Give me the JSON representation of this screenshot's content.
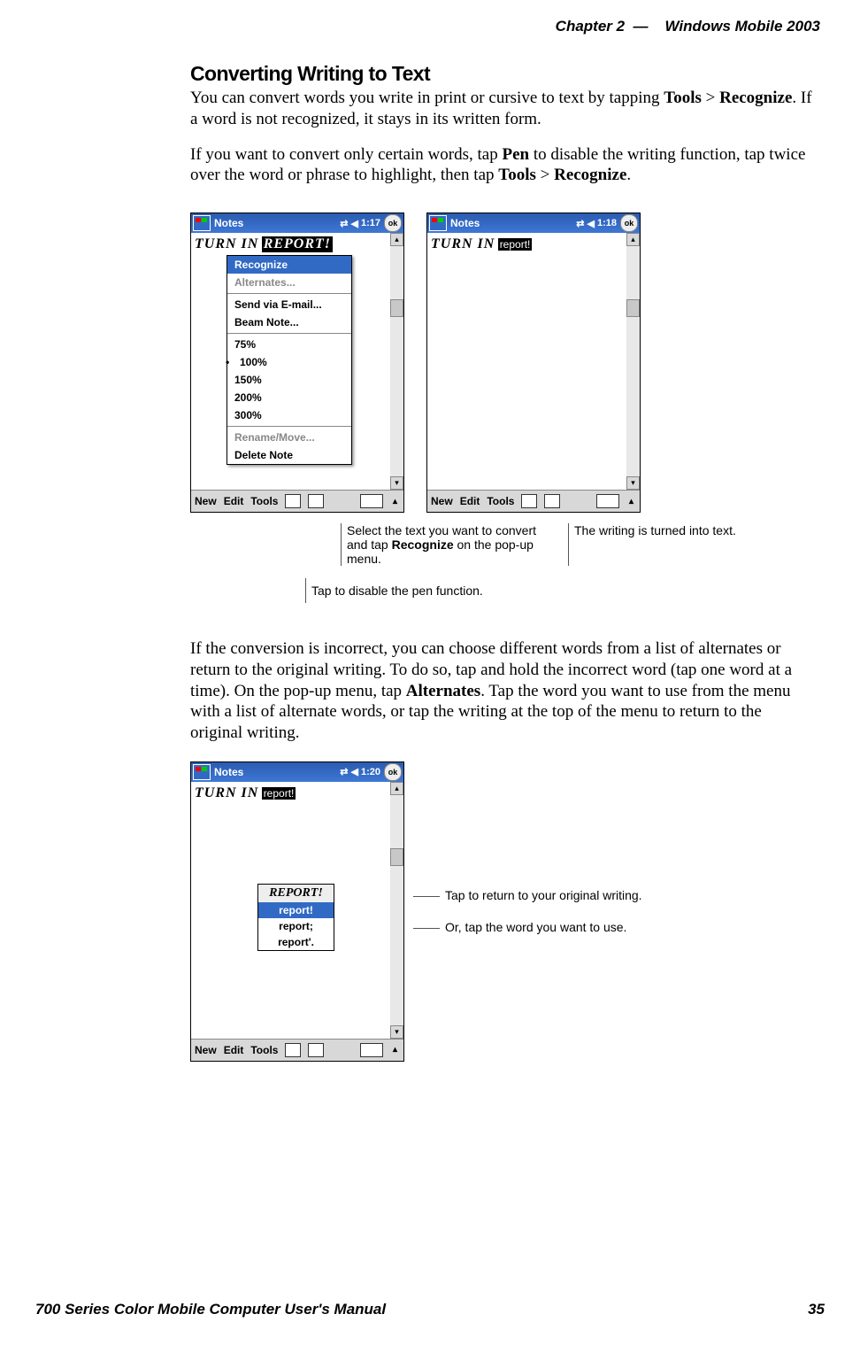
{
  "header": {
    "chapter": "Chapter  2",
    "dash": "—",
    "product": "Windows Mobile 2003"
  },
  "section_title": "Converting Writing to Text",
  "para1_a": "You can convert words you write in print or cursive to text by tapping ",
  "para1_tools": "Tools",
  "para1_gt": " > ",
  "para1_recognize": "Recognize",
  "para1_b": ". If a word is not recognized, it stays in its written form.",
  "para2_a": "If you want to convert only certain words, tap ",
  "para2_pen": "Pen",
  "para2_b": " to disable the writing function, tap twice over the word or phrase to highlight, then tap ",
  "para2_tools": "Tools",
  "para2_gt": " > ",
  "para2_recognize": "Recognize",
  "para2_c": ".",
  "shot1": {
    "title": "Notes",
    "time": "1:17",
    "handwriting_a": "TURN IN",
    "handwriting_b": "REPORT!",
    "menu": {
      "recognize": "Recognize",
      "alternates": "Alternates...",
      "send_email": "Send via E-mail...",
      "beam": "Beam Note...",
      "z75": "75%",
      "z100": "100%",
      "z150": "150%",
      "z200": "200%",
      "z300": "300%",
      "rename": "Rename/Move...",
      "delete": "Delete Note"
    },
    "bottom": {
      "new": "New",
      "edit": "Edit",
      "tools": "Tools"
    }
  },
  "shot2": {
    "title": "Notes",
    "time": "1:18",
    "handwriting_a": "TURN IN",
    "converted": "report!",
    "bottom": {
      "new": "New",
      "edit": "Edit",
      "tools": "Tools"
    }
  },
  "callout1_a": "Select the text you want to convert and tap ",
  "callout1_b": "Recognize",
  "callout1_c": " on the pop-up menu.",
  "callout2": "The writing is turned into text.",
  "callout3": "Tap to disable the pen function.",
  "para3_a": "If the conversion is incorrect, you can choose different words from a list of alternates or return to the original writing. To do so, tap and hold the incorrect word (tap one word at a time). On the pop-up menu, tap ",
  "para3_alt": "Alternates",
  "para3_b": ". Tap the word you want to use from the menu with a list of alternate words, or tap the writing at the top of the menu to return to the original writing.",
  "shot3": {
    "title": "Notes",
    "time": "1:20",
    "handwriting_a": "TURN IN",
    "converted": "report!",
    "alt": {
      "orig": "REPORT!",
      "a1": "report!",
      "a2": "report;",
      "a3": "report'."
    },
    "bottom": {
      "new": "New",
      "edit": "Edit",
      "tools": "Tools"
    }
  },
  "side_callout1": "Tap to return to your original writing.",
  "side_callout2": "Or, tap the word you want to use.",
  "footer": {
    "manual": "700 Series Color Mobile Computer User's Manual",
    "page": "35"
  }
}
